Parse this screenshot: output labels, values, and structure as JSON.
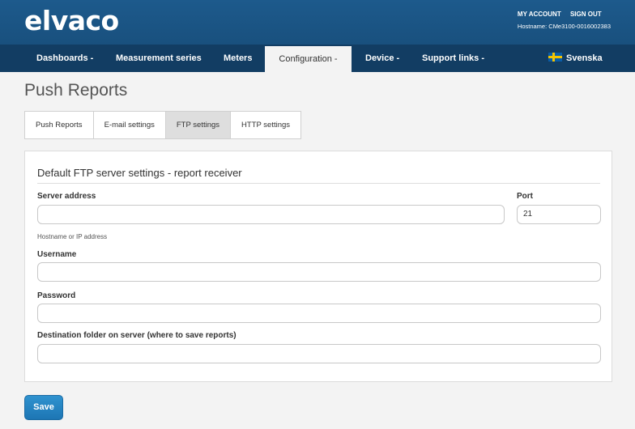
{
  "brand": {
    "logo": "elvaco"
  },
  "account": {
    "my_account": "MY ACCOUNT",
    "sign_out": "SIGN OUT",
    "hostname": "Hostname: CMe3100-0016002383"
  },
  "nav": {
    "items": [
      {
        "label": "Dashboards -"
      },
      {
        "label": "Measurement series"
      },
      {
        "label": "Meters"
      },
      {
        "label": "Configuration -"
      },
      {
        "label": "Device -"
      },
      {
        "label": "Support links -"
      }
    ],
    "active": "Configuration -",
    "language": "Svenska"
  },
  "page": {
    "title": "Push Reports"
  },
  "tabs": [
    {
      "label": "Push Reports"
    },
    {
      "label": "E-mail settings"
    },
    {
      "label": "FTP settings"
    },
    {
      "label": "HTTP settings"
    }
  ],
  "active_tab": "FTP settings",
  "form": {
    "section_title": "Default FTP server settings - report receiver",
    "server_address": {
      "label": "Server address",
      "value": "",
      "help": "Hostname or IP address"
    },
    "port": {
      "label": "Port",
      "value": "21"
    },
    "username": {
      "label": "Username",
      "value": ""
    },
    "password": {
      "label": "Password",
      "value": ""
    },
    "destination": {
      "label": "Destination folder on server (where to save reports)",
      "value": ""
    }
  },
  "actions": {
    "save": "Save"
  },
  "colors": {
    "header": "#1d5a8c",
    "nav": "#123d63",
    "button": "#1d76b4"
  }
}
